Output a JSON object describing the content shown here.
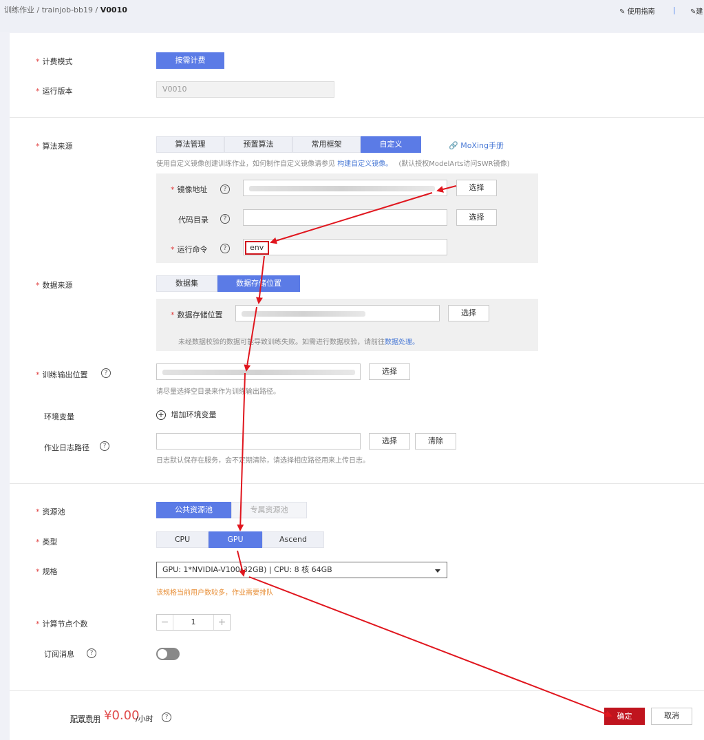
{
  "breadcrumb": {
    "item1": "训练作业",
    "sep1": "/",
    "item2": "trainjob-bb19",
    "sep2": "/",
    "current": "V0010"
  },
  "header": {
    "guide_label": "使用指南",
    "separator": "|",
    "second_label": "建"
  },
  "billing": {
    "label": "计费模式",
    "value": "按需计费"
  },
  "version": {
    "label": "运行版本",
    "value": "V0010"
  },
  "algorithm": {
    "label": "算法来源",
    "tabs": [
      "算法管理",
      "预置算法",
      "常用框架",
      "自定义"
    ],
    "active_tab": "自定义",
    "moxing_link": "MoXing手册",
    "hint_prefix": "使用自定义镜像创建训练作业，如何制作自定义镜像请参见",
    "hint_link": "构建自定义镜像。",
    "hint_suffix": "(默认授权ModelArts访问SWR镜像)",
    "image_label": "镜像地址",
    "image_select": "选择",
    "code_label": "代码目录",
    "code_select": "选择",
    "command_label": "运行命令",
    "command_value": "env"
  },
  "data_source": {
    "label": "数据来源",
    "tabs": [
      "数据集",
      "数据存储位置"
    ],
    "active_tab": "数据存储位置",
    "storage_label": "数据存储位置",
    "storage_select": "选择",
    "hint_prefix": "未经数据校验的数据可能导致训练失败。如需进行数据校验，请前往",
    "hint_link": "数据处理。"
  },
  "output": {
    "label": "训练输出位置",
    "select": "选择",
    "hint": "请尽量选择空目录来作为训练输出路径。"
  },
  "env": {
    "label": "环境变量",
    "add_label": "增加环境变量"
  },
  "log": {
    "label": "作业日志路径",
    "select": "选择",
    "clear": "清除",
    "hint": "日志默认保存在服务，会不定期清除，请选择相应路径用来上传日志。"
  },
  "pool": {
    "label": "资源池",
    "public": "公共资源池",
    "dedicated": "专属资源池"
  },
  "type": {
    "label": "类型",
    "options": [
      "CPU",
      "GPU",
      "Ascend"
    ],
    "active": "GPU"
  },
  "spec": {
    "label": "规格",
    "value": "GPU: 1*NVIDIA-V100(32GB) | CPU: 8 核 64GB",
    "warning": "该规格当前用户数较多，作业需要排队"
  },
  "nodes": {
    "label": "计算节点个数",
    "value": "1",
    "minus": "−",
    "plus": "+"
  },
  "subscribe": {
    "label": "订阅消息"
  },
  "footer": {
    "cost_label": "配置费用",
    "price": "¥0.00",
    "unit": "/小时",
    "confirm": "确定",
    "cancel": "取消"
  },
  "colors": {
    "primary": "#5b7be6",
    "danger": "#c0141e",
    "annotation": "#e0161e",
    "warning": "#e8903a"
  }
}
